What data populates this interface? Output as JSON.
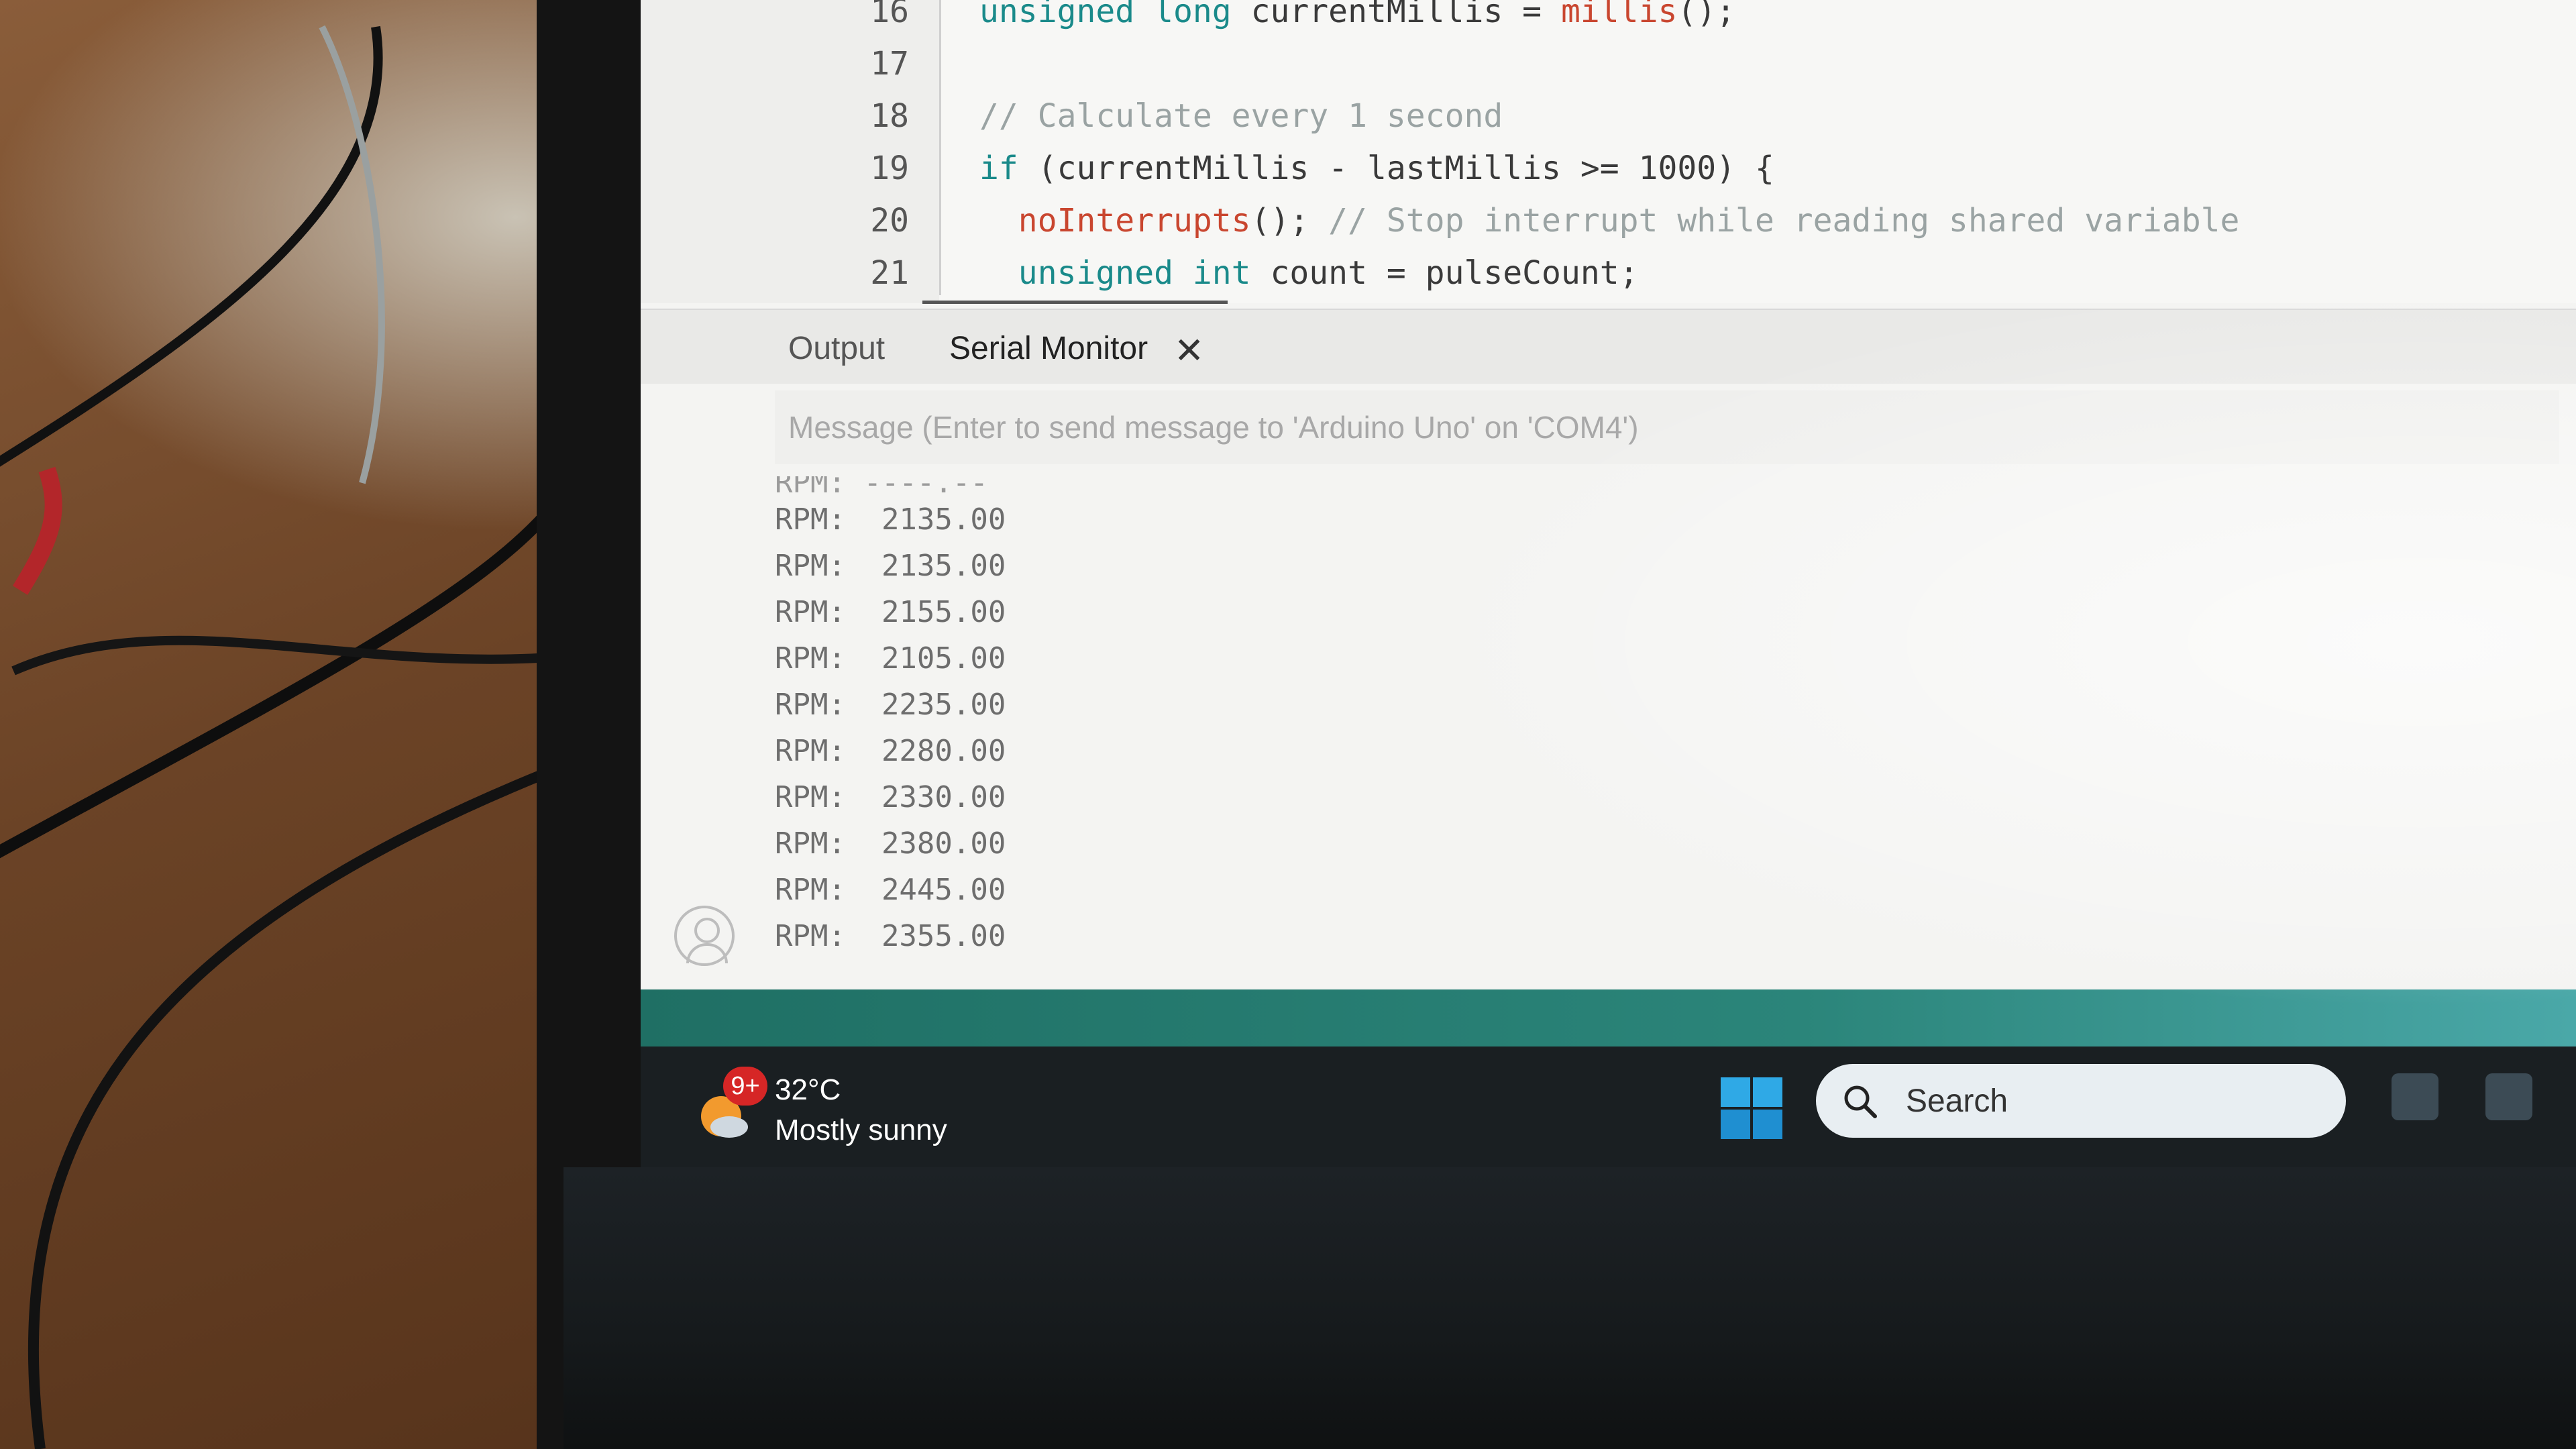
{
  "editor": {
    "lines": [
      {
        "number": "16",
        "tokens": [
          [
            "kw",
            "unsigned long"
          ],
          [
            "plain",
            " currentMillis = "
          ],
          [
            "fn",
            "millis"
          ],
          [
            "plain",
            "();"
          ]
        ]
      },
      {
        "number": "17",
        "tokens": []
      },
      {
        "number": "18",
        "tokens": [
          [
            "cm",
            "// Calculate every 1 second"
          ]
        ]
      },
      {
        "number": "19",
        "tokens": [
          [
            "kw",
            "if"
          ],
          [
            "plain",
            " (currentMillis - lastMillis >= 1000) {"
          ]
        ]
      },
      {
        "number": "20",
        "tokens": [
          [
            "plain",
            "  "
          ],
          [
            "fn",
            "noInterrupts"
          ],
          [
            "plain",
            "(); "
          ],
          [
            "cm",
            "// Stop interrupt while reading shared variable"
          ]
        ]
      },
      {
        "number": "21",
        "tokens": [
          [
            "plain",
            "  "
          ],
          [
            "kw",
            "unsigned int"
          ],
          [
            "plain",
            " count = pulseCount;"
          ]
        ]
      }
    ]
  },
  "panel": {
    "tabs": [
      {
        "label": "Output"
      },
      {
        "label": "Serial Monitor"
      }
    ],
    "close_symbol": "✕",
    "message_placeholder": "Message (Enter to send message to 'Arduino Uno' on 'COM4')"
  },
  "serial_output": {
    "partial_line": "RPM:  ----.--",
    "lines": [
      "RPM:  2135.00",
      "RPM:  2135.00",
      "RPM:  2155.00",
      "RPM:  2105.00",
      "RPM:  2235.00",
      "RPM:  2280.00",
      "RPM:  2330.00",
      "RPM:  2380.00",
      "RPM:  2445.00",
      "RPM:  2355.00"
    ]
  },
  "taskbar": {
    "weather": {
      "badge": "9+",
      "temperature": "32°C",
      "condition": "Mostly sunny"
    },
    "search_label": "Search"
  },
  "colors": {
    "status_bar": "#2b857a",
    "keyword": "#1a8a8a",
    "function": "#c9462f",
    "comment": "#9aa3a3"
  }
}
